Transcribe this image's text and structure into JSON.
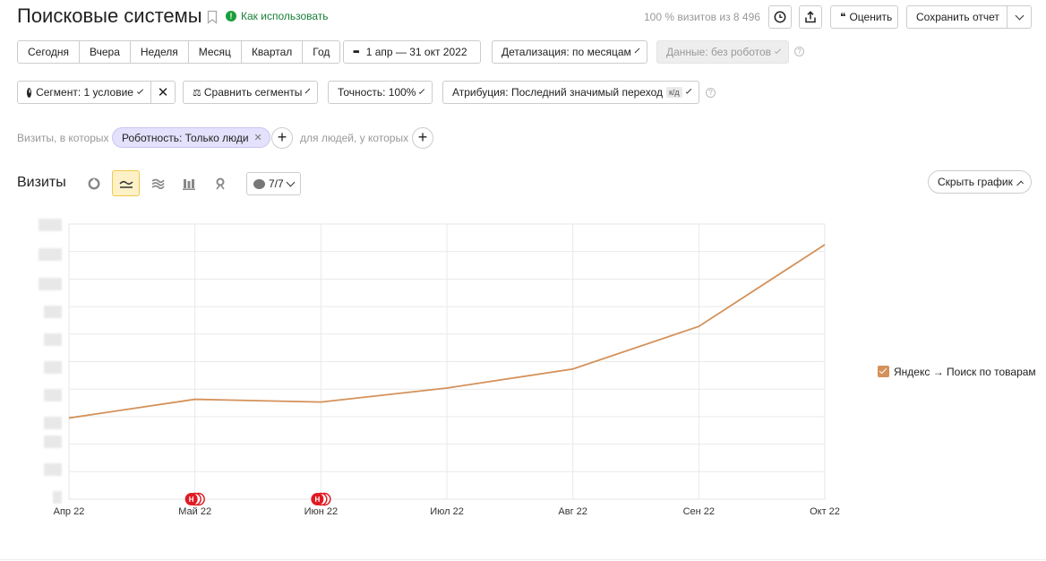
{
  "header": {
    "title": "Поисковые системы",
    "how_to_use": "Как использовать",
    "visits_info": "100 % визитов из 8 496",
    "rate_label": "Оценить",
    "save_report_label": "Сохранить отчет"
  },
  "period_buttons": [
    "Сегодня",
    "Вчера",
    "Неделя",
    "Месяц",
    "Квартал",
    "Год"
  ],
  "filters": {
    "date_range": "1 апр — 31 окт 2022",
    "detail": "Детализация: по месяцам",
    "data": "Данные: без роботов",
    "segment": "Сегмент: 1 условие",
    "compare": "Сравнить сегменты",
    "accuracy": "Точность: 100%",
    "attribution": "Атрибуция: Последний значимый переход",
    "attribution_badge": "к/д"
  },
  "segment_row": {
    "visits_label": "Визиты, в которых",
    "tag": "Роботность: Только люди",
    "people_label": "для людей, у которых"
  },
  "chart_header": {
    "title": "Визиты",
    "annotations": "7/7",
    "hide_chart": "Скрыть график"
  },
  "colors": {
    "series": "#d4915a",
    "marker": "#e01b24",
    "tag_bg": "#e3e1fb",
    "active_view": "#fdf1c8"
  },
  "chart_data": {
    "type": "line",
    "x": [
      "Апр 22",
      "Май 22",
      "Июн 22",
      "Июл 22",
      "Авг 22",
      "Сен 22",
      "Окт 22"
    ],
    "series": [
      {
        "name": "Яндекс → Поиск по товарам",
        "values": [
          29.5,
          36.3,
          35.3,
          40.4,
          47.3,
          62.8,
          92.5
        ]
      }
    ],
    "ylim": [
      0,
      100
    ],
    "y_tick_labels_hidden": true,
    "grid": true,
    "legend": "right",
    "event_markers": [
      {
        "x": "Май 22",
        "label": "Н"
      },
      {
        "x": "Июн 22",
        "label": "Н"
      }
    ]
  }
}
